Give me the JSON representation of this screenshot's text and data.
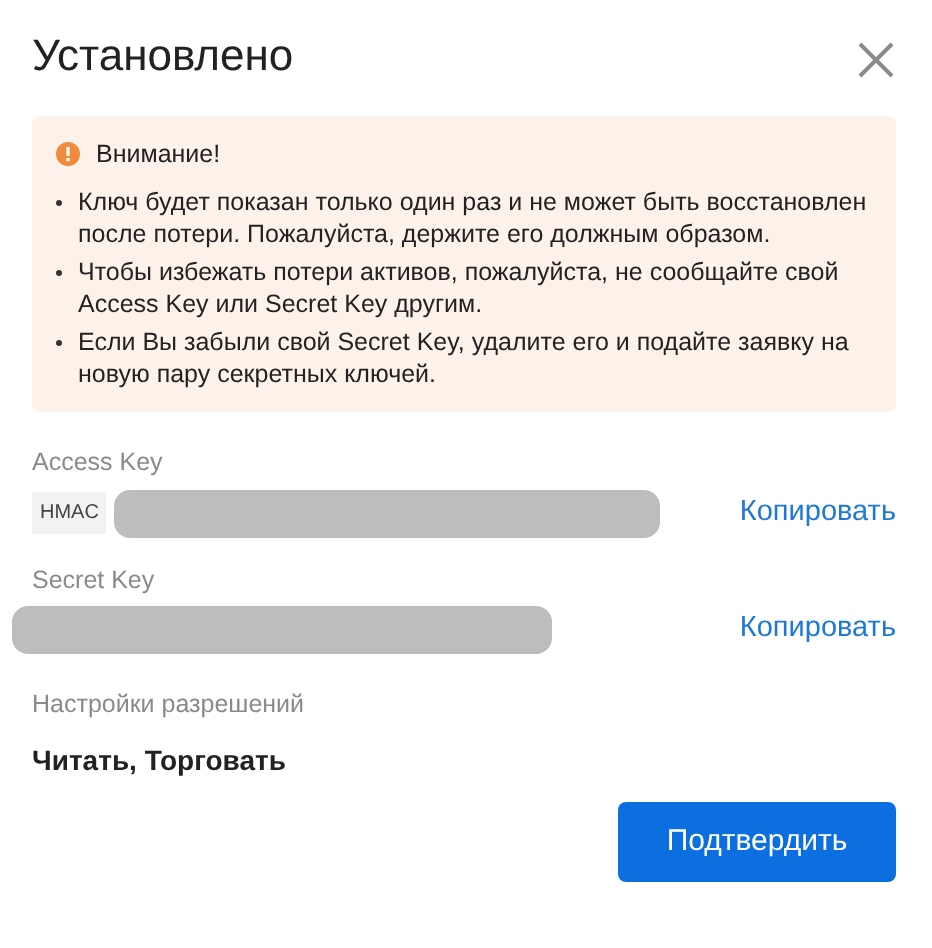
{
  "dialog": {
    "title": "Установлено"
  },
  "warning": {
    "title": "Внимание!",
    "items": [
      "Ключ будет показан только один раз и не может быть восстановлен после потери. Пожалуйста, держите его должным образом.",
      "Чтобы избежать потери активов, пожалуйста, не сообщайте свой Access Key или Secret Key другим.",
      "Если Вы забыли свой Secret Key, удалите его и подайте заявку на новую пару секретных ключей."
    ]
  },
  "keys": [
    {
      "label": "Access Key",
      "tag": "HMAC",
      "redacted": true,
      "copy_label": "Копировать"
    },
    {
      "label": "Secret Key",
      "redacted": true,
      "copy_label": "Копировать"
    }
  ],
  "permissions": {
    "label": "Настройки разрешений",
    "value": "Читать, Торговать"
  },
  "confirm_button": "Подтвердить"
}
